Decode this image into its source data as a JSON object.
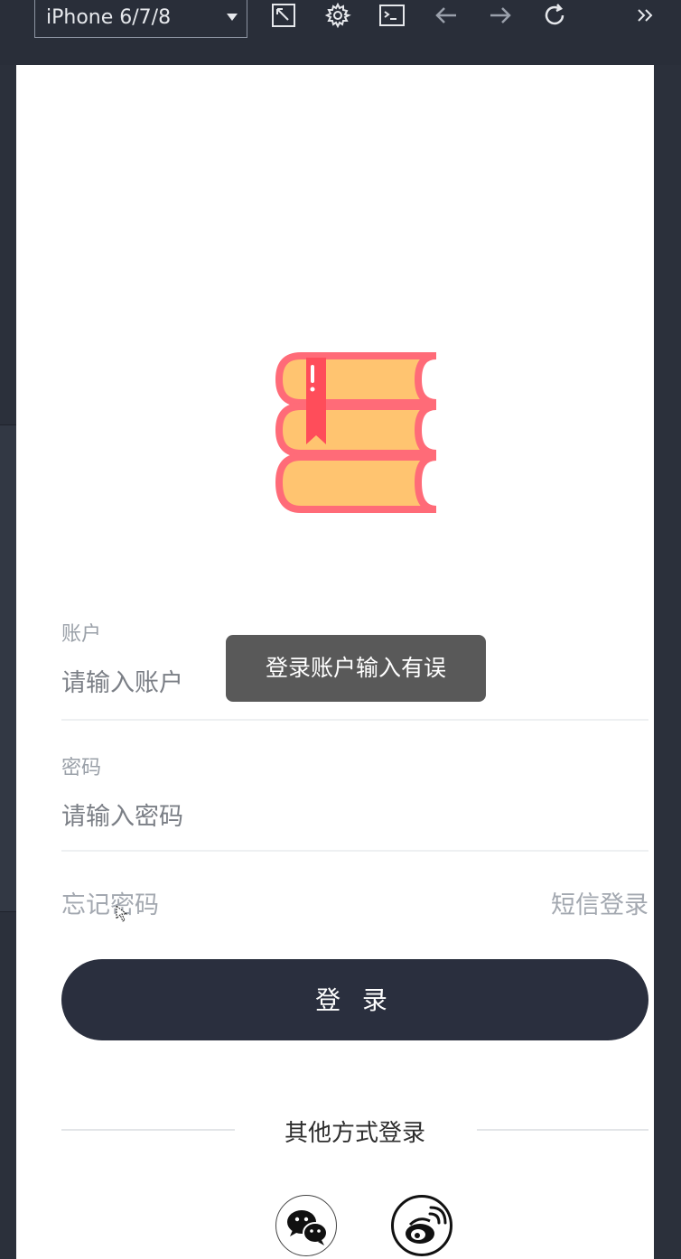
{
  "toolbar": {
    "device": "iPhone 6/7/8",
    "icons": [
      "rotate-icon",
      "settings-icon",
      "console-icon",
      "back-icon",
      "forward-icon",
      "reload-icon",
      "more-icon"
    ]
  },
  "login": {
    "account_label": "账户",
    "account_placeholder": "请输入账户",
    "password_label": "密码",
    "password_placeholder": "请输入密码",
    "forgot_password": "忘记密码",
    "sms_login": "短信登录",
    "login_button": "登 录",
    "other_methods": "其他方式登录",
    "toast": "登录账户输入有误"
  },
  "social": [
    "wechat-icon",
    "weibo-icon"
  ],
  "colors": {
    "toolbar_bg": "#292e39",
    "button_bg": "#2a2f3e",
    "toast_bg": "#595959",
    "book_fill": "#ffc470",
    "book_stroke": "#ff6b78",
    "bookmark": "#ff4d5a"
  }
}
